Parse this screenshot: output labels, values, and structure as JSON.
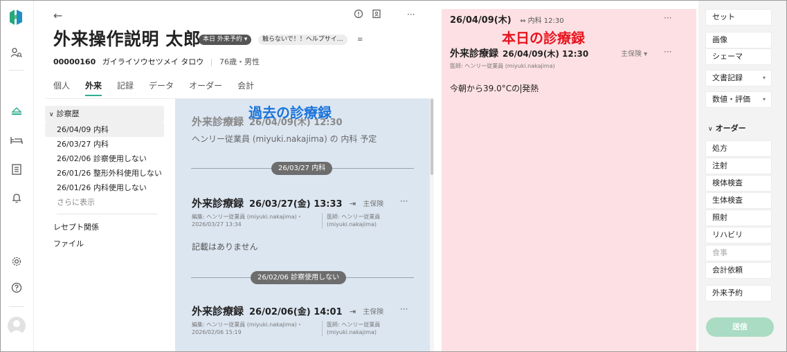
{
  "header": {
    "patient_name": "外来操作説明 太郎",
    "badge_reservation": "本日 外来予約 ▾",
    "badge_note": "触らないで！！ヘルプサイ…",
    "patient_id": "00000160",
    "patient_kana": "ガイライソウセツメイ タロウ",
    "age_sex": "76歳・男性"
  },
  "tabs": [
    "個人",
    "外来",
    "記録",
    "データ",
    "オーダー",
    "会計"
  ],
  "history": {
    "heading": "診察歴",
    "items": [
      "26/04/09 内科",
      "26/03/27 内科",
      "26/02/06 診察使用しない",
      "26/01/26 整形外科使用しない",
      "26/01/26 内科使用しない"
    ],
    "more": "さらに表示",
    "links": [
      "レセプト関係",
      "ファイル"
    ]
  },
  "past": {
    "overlay_label": "過去の診療録",
    "top_title": "外来診療録",
    "top_date": "26/04/09(木) 12:30",
    "top_sub": "ヘンリー従業員 (miyuki.nakajima) の 内科 予定",
    "divider1": "26/03/27  内科",
    "rec1": {
      "title": "外来診療録",
      "date": "26/03/27(金) 13:33",
      "insurance": "主保険",
      "edit_line1": "編集: ヘンリー従業員 (miyuki.nakajima)・",
      "edit_line2": "2026/03/27 13:34",
      "doc_line1": "医師: ヘンリー従業員",
      "doc_line2": "(miyuki.nakajima)",
      "body": "記載はありません"
    },
    "divider2": "26/02/06  診察使用しない",
    "rec2": {
      "title": "外来診療録",
      "date": "26/02/06(金) 14:01",
      "insurance": "主保険",
      "edit_line1": "編集: ヘンリー従業員 (miyuki.nakajima)・",
      "edit_line2": "2026/02/06 15:19",
      "doc_line1": "医師: ヘンリー従業員",
      "doc_line2": "(miyuki.nakajima)"
    }
  },
  "today": {
    "top_date": "26/04/09(木)",
    "top_link": "内科 12:30",
    "overlay_label": "本日の診療録",
    "title": "外来診療録",
    "date": "26/04/09(木) 12:30",
    "insurance": "主保険 ▾",
    "doctor": "医師: ヘンリー従業員 (miyuki.nakajima)",
    "body_before": "今朝から39.0°Cの",
    "body_after": "発熱"
  },
  "right_panel": {
    "set": "セット",
    "image": "画像",
    "schema": "シェーマ",
    "document": "文書記録",
    "values": "数値・評価",
    "order_head": "オーダー",
    "orders": [
      "処方",
      "注射",
      "検体検査",
      "生体検査",
      "照射",
      "リハビリ",
      "食事",
      "会計依頼"
    ],
    "appointment": "外来予約",
    "send": "送信"
  },
  "colors": {
    "accent_green": "#2fae8f",
    "past_bg": "#dce6f1",
    "today_bg": "#fde0e3",
    "overlay_blue": "#1a73d9",
    "overlay_red": "#e8141e",
    "send_bg": "#a9dcc2"
  },
  "icons": {
    "rail": [
      "brand-logo-icon",
      "patient-search-icon",
      "reception-icon",
      "bed-icon",
      "list-icon",
      "bell-icon",
      "settings-icon",
      "help-icon"
    ],
    "header": [
      "back-arrow-icon",
      "info-icon",
      "id-card-icon",
      "more-icon"
    ]
  }
}
